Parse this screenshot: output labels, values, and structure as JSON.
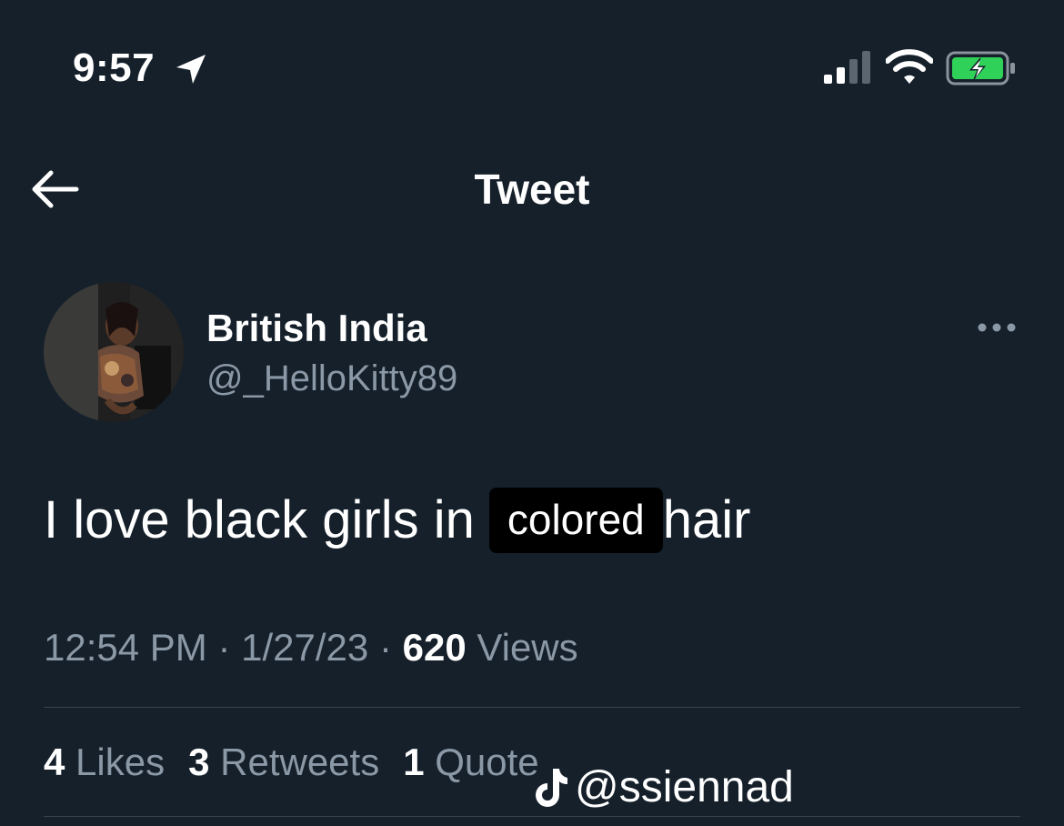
{
  "status_bar": {
    "time": "9:57",
    "icons": [
      "location-arrow-icon",
      "cellular-signal-icon",
      "wifi-icon",
      "battery-charging-icon"
    ],
    "battery_color": "#30d158"
  },
  "header": {
    "title": "Tweet",
    "back_icon": "back-arrow-icon"
  },
  "tweet": {
    "author": {
      "display_name": "British India",
      "handle": "@_HelloKitty89"
    },
    "text": {
      "before": "I love black girls in",
      "highlighted": "colored",
      "after": "hair"
    },
    "meta": {
      "time": "12:54 PM",
      "sep1": "·",
      "date": "1/27/23",
      "sep2": "·",
      "views_count": "620",
      "views_label": "Views"
    },
    "stats": {
      "likes_count": "4",
      "likes_label": "Likes",
      "retweets_count": "3",
      "retweets_label": "Retweets",
      "quotes_count": "1",
      "quotes_label": "Quote"
    }
  },
  "watermark": {
    "text": "@ssiennad",
    "icon": "tiktok-icon"
  },
  "colors": {
    "background": "#15202b",
    "primary_text": "#ffffff",
    "secondary_text": "#8b98a5",
    "divider": "#38444d",
    "highlight_bg": "#000000"
  }
}
